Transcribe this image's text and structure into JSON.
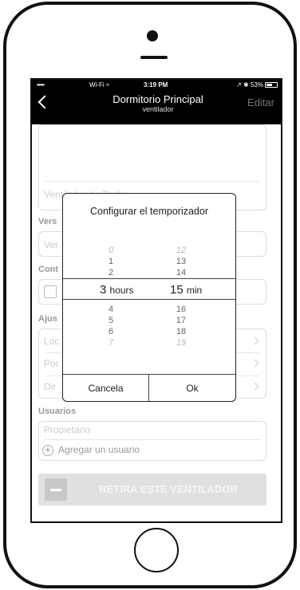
{
  "status": {
    "signal": "•••••",
    "wifi": "Wi-Fi ≈",
    "time": "3:19 PM",
    "right": "↗ ✱ 53%"
  },
  "nav": {
    "title": "Dormitorio Principal",
    "subtitle": "ventilador",
    "edit_label": "Editar"
  },
  "background": {
    "name_field": "Ventilador de Techo",
    "version_label": "Vers",
    "version_value": "Ver",
    "control_label": "Cont",
    "adjust_label": "Ajus",
    "row1": "Loc",
    "row2": "Por",
    "row3": "Dir",
    "users_label": "Usuarios",
    "owner": "Propietario",
    "add_user": "Agregar un usuario",
    "remove_button": "RETIRA ESTE VENTILADOR"
  },
  "dialog": {
    "title": "Configurar el temporizador",
    "hours_above": [
      "0",
      "1",
      "2"
    ],
    "hours_selected": "3",
    "hours_unit": "hours",
    "hours_below": [
      "4",
      "5",
      "6",
      "7"
    ],
    "minutes_above": [
      "12",
      "13",
      "14"
    ],
    "minutes_selected": "15",
    "minutes_unit": "min",
    "minutes_below": [
      "16",
      "17",
      "18",
      "19"
    ],
    "cancel_label": "Cancela",
    "ok_label": "Ok"
  }
}
